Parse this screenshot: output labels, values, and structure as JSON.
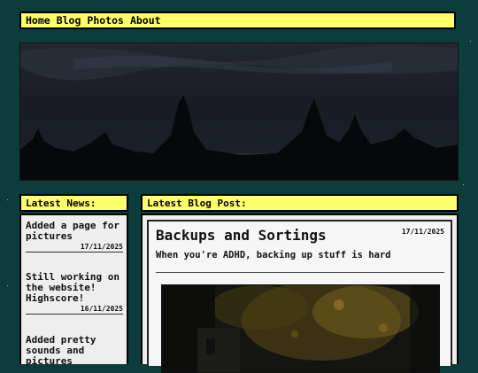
{
  "nav": {
    "items": [
      "Home",
      "Blog",
      "Photos",
      "About"
    ]
  },
  "news": {
    "heading": "Latest News:",
    "items": [
      {
        "title": "Added a page for pictures",
        "date": "17/11/2025"
      },
      {
        "title": "Still working on the website! Highscore!",
        "date": "16/11/2025"
      },
      {
        "title": "Added pretty sounds and pictures",
        "date": ""
      }
    ]
  },
  "blog": {
    "heading": "Latest Blog Post:",
    "post": {
      "title": "Backups and Sortings",
      "date": "17/11/2025",
      "subtitle": "When you're ADHD, backing up stuff is hard"
    }
  },
  "colors": {
    "background": "#0d3d3a",
    "accent": "#fffe6b",
    "panel": "#eeeeee"
  }
}
